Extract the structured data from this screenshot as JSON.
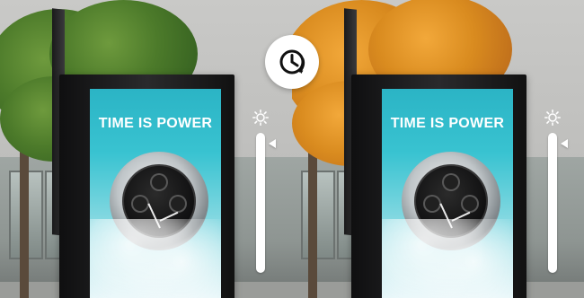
{
  "panels": {
    "left": {
      "headline": "TIME IS POWER",
      "season": "summer",
      "brightness_level": 0.95
    },
    "right": {
      "headline": "TIME IS POWER",
      "season": "autumn",
      "brightness_level": 0.95
    }
  },
  "controls": {
    "brightness_icon": "sun-icon",
    "time_toggle_icon": "clock-refresh-icon"
  },
  "colors": {
    "screen_teal": "#2bb4c5",
    "tree_green": "#4c7a2a",
    "tree_orange": "#d98b1f",
    "kiosk_black": "#111111",
    "slider_white": "#ffffff"
  }
}
